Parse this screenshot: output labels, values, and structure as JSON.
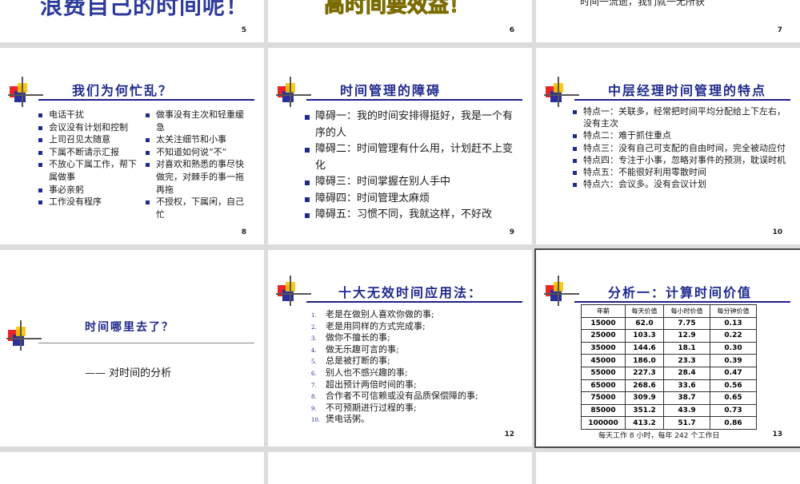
{
  "slides": {
    "s5": {
      "num": "5",
      "fragment": "浪费自己的时间呢！"
    },
    "s6": {
      "num": "6",
      "fragment": "高时间要效益！"
    },
    "s7": {
      "num": "7",
      "fragment": "时间一流逝，我们就一无所获"
    },
    "s8": {
      "num": "8",
      "title": "我们为何忙乱？",
      "col1": [
        "电话干扰",
        "会议没有计划和控制",
        "上司召见太随意",
        "下属不断请示汇报",
        "不放心下属工作，帮下属做事",
        "事必亲躬",
        "工作没有程序"
      ],
      "col2": [
        "做事没有主次和轻重缓急",
        "太关注细节和小事",
        "不知道如何说“不”",
        "对喜欢和熟悉的事尽快做完，对棘手的事一拖再拖",
        "不授权，下属闲，自己忙"
      ]
    },
    "s9": {
      "num": "9",
      "title": "时间管理的障碍",
      "items": [
        "障碍一：我的时间安排得挺好，我是一个有序的人",
        "障碍二：时间管理有什么用，计划赶不上变化",
        "障碍三：时间掌握在别人手中",
        "障碍四：时间管理太麻烦",
        "障碍五：习惯不同，我就这样，不好改"
      ]
    },
    "s10": {
      "num": "10",
      "title": "中层经理时间管理的特点",
      "items": [
        "特点一：关联多，经常把时间平均分配给上下左右，没有主次",
        "特点二：难于抓住重点",
        "特点三：没有自己可支配的自由时间，完全被动应付",
        "特点四：专注于小事，忽略对事件的预测，耽误时机",
        "特点五：不能很好利用零散时间",
        "特点六：会议多。没有会议计划"
      ]
    },
    "s11": {
      "title": "时间哪里去了？",
      "subtitle": "—— 对时间的分析"
    },
    "s12": {
      "num": "12",
      "title": "十大无效时间应用法：",
      "items": [
        "老是在做别人喜欢你做的事;",
        "老是用同样的方式完成事;",
        "做你不擅长的事;",
        "做无乐趣可言的事;",
        "总是被打断的事;",
        "别人也不感兴趣的事;",
        "超出预计两倍时间的事;",
        "合作者不可信赖或没有品质保偿障的事;",
        "不可预期进行过程的事;",
        "煲电话粥。"
      ],
      "markers": [
        "1.",
        "2.",
        "3.",
        "4.",
        "5.",
        "6.",
        "7.",
        "8.",
        "9.",
        "10."
      ]
    },
    "s13": {
      "num": "13",
      "title": "分析一：计算时间价值",
      "headers": [
        "年薪",
        "每天价值",
        "每小时价值",
        "每分钟价值"
      ],
      "rows": [
        [
          "15000",
          "62.0",
          "7.75",
          "0.13"
        ],
        [
          "25000",
          "103.3",
          "12.9",
          "0.22"
        ],
        [
          "35000",
          "144.6",
          "18.1",
          "0.30"
        ],
        [
          "45000",
          "186.0",
          "23.3",
          "0.39"
        ],
        [
          "55000",
          "227.3",
          "28.4",
          "0.47"
        ],
        [
          "65000",
          "268.6",
          "33.6",
          "0.56"
        ],
        [
          "75000",
          "309.9",
          "38.7",
          "0.65"
        ],
        [
          "85000",
          "351.2",
          "43.9",
          "0.73"
        ],
        [
          "100000",
          "413.2",
          "51.7",
          "0.86"
        ]
      ],
      "note": "每天工作 8 小时，每年 242 个工作日"
    }
  },
  "colors": {
    "title": "#1f2a8c",
    "logo_red": "#e8262a",
    "logo_yellow": "#f5c400",
    "logo_blue": "#2a2f9a"
  }
}
